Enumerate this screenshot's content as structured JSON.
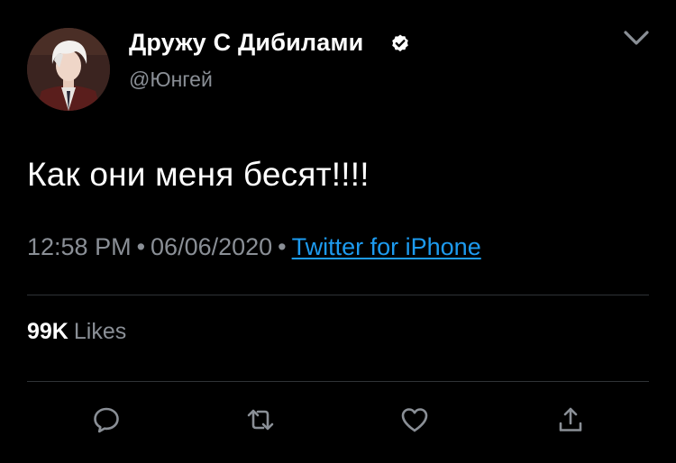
{
  "author": {
    "display_name": "Дружу С Дибилами",
    "handle": "@Юнгей",
    "verified": true
  },
  "tweet": {
    "text": "Как они меня бесят!!!!",
    "time": "12:58 PM",
    "separator": "•",
    "date": "06/06/2020",
    "source": "Twitter for iPhone"
  },
  "stats": {
    "likes_count": "99K",
    "likes_label": "Likes"
  },
  "icons": {
    "menu": "chevron-down-icon",
    "verified": "verified-badge-icon",
    "reply": "reply-icon",
    "retweet": "retweet-icon",
    "like": "heart-icon",
    "share": "share-icon"
  },
  "colors": {
    "background": "#000000",
    "text_primary": "#ffffff",
    "text_secondary": "#8a8f96",
    "link": "#1d9bf0",
    "divider": "#2f3336"
  }
}
